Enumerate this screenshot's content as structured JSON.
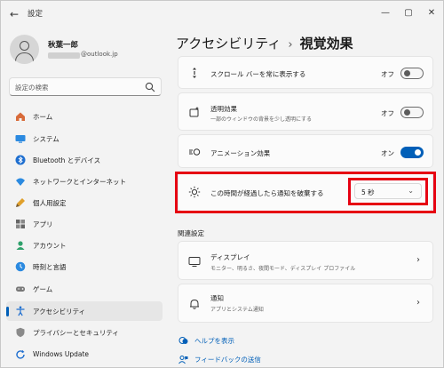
{
  "window": {
    "title": "設定"
  },
  "user": {
    "name": "秋葉一郎",
    "email_suffix": "@outlook.jp"
  },
  "search": {
    "placeholder": "設定の検索"
  },
  "sidebar": {
    "items": [
      {
        "label": "ホーム",
        "icon": "home-icon"
      },
      {
        "label": "システム",
        "icon": "system-icon"
      },
      {
        "label": "Bluetooth とデバイス",
        "icon": "bluetooth-icon"
      },
      {
        "label": "ネットワークとインターネット",
        "icon": "wifi-icon"
      },
      {
        "label": "個人用設定",
        "icon": "brush-icon"
      },
      {
        "label": "アプリ",
        "icon": "apps-icon"
      },
      {
        "label": "アカウント",
        "icon": "account-icon"
      },
      {
        "label": "時刻と言語",
        "icon": "time-language-icon"
      },
      {
        "label": "ゲーム",
        "icon": "gaming-icon"
      },
      {
        "label": "アクセシビリティ",
        "icon": "accessibility-icon",
        "active": true
      },
      {
        "label": "プライバシーとセキュリティ",
        "icon": "shield-icon"
      },
      {
        "label": "Windows Update",
        "icon": "update-icon"
      }
    ]
  },
  "breadcrumb": {
    "parent": "アクセシビリティ",
    "separator": "›",
    "current": "視覚効果"
  },
  "settings": {
    "scrollbars": {
      "title": "スクロール バーを常に表示する",
      "state_label": "オフ",
      "on": false
    },
    "transparency": {
      "title": "透明効果",
      "subtitle": "一部のウィンドウの背景を少し透明にする",
      "state_label": "オフ",
      "on": false
    },
    "animation": {
      "title": "アニメーション効果",
      "state_label": "オン",
      "on": true
    },
    "notifications": {
      "title": "この時間が経過したら通知を破棄する",
      "value": "5 秒"
    }
  },
  "related": {
    "heading": "関連設定",
    "items": [
      {
        "title": "ディスプレイ",
        "subtitle": "モニター、明るさ、夜間モード、ディスプレイ プロファイル"
      },
      {
        "title": "通知",
        "subtitle": "アプリとシステム通知"
      }
    ]
  },
  "links": {
    "help": "ヘルプを表示",
    "feedback": "フィードバックの送信"
  },
  "colors": {
    "accent": "#005fb8",
    "highlight": "#e60012"
  }
}
